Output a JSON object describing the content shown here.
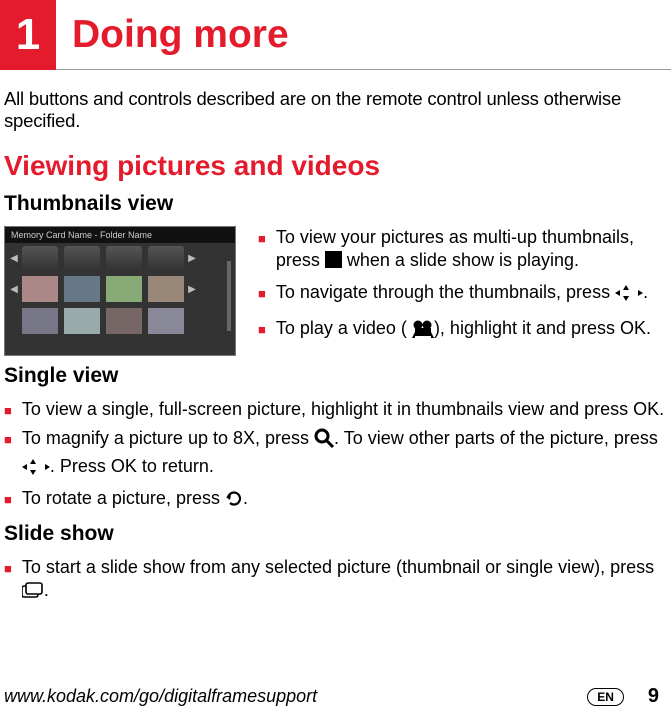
{
  "chapter": {
    "num": "1",
    "title": "Doing more"
  },
  "intro": "All buttons and controls described are on the remote control unless otherwise specified.",
  "h2": "Viewing pictures and videos",
  "h3a": "Thumbnails view",
  "thumb_header": "Memory Card Name - Folder Name",
  "thumbs": {
    "b1a": "To view your pictures as multi-up thumbnails, press ",
    "b1b": " when a slide show is playing.",
    "b2a": "To navigate through the thumbnails, press ",
    "b2b": ".",
    "b3a": "To play a video ( ",
    "b3b": "), highlight it and press OK."
  },
  "h3b": "Single view",
  "single": {
    "s1": "To view a single, full-screen picture, highlight it in thumbnails view and press OK.",
    "s2a": "To magnify a picture up to 8X, press ",
    "s2b": ". To view other parts of the picture, press ",
    "s2c": ". Press OK to return.",
    "s3a": "To rotate a picture, press ",
    "s3b": "."
  },
  "h3c": "Slide show",
  "slide": {
    "s1a": "To start a slide show from any selected picture (thumbnail or single view), press ",
    "s1b": "."
  },
  "footer": {
    "url": "www.kodak.com/go/digitalframesupport",
    "lang": "EN",
    "page": "9"
  }
}
